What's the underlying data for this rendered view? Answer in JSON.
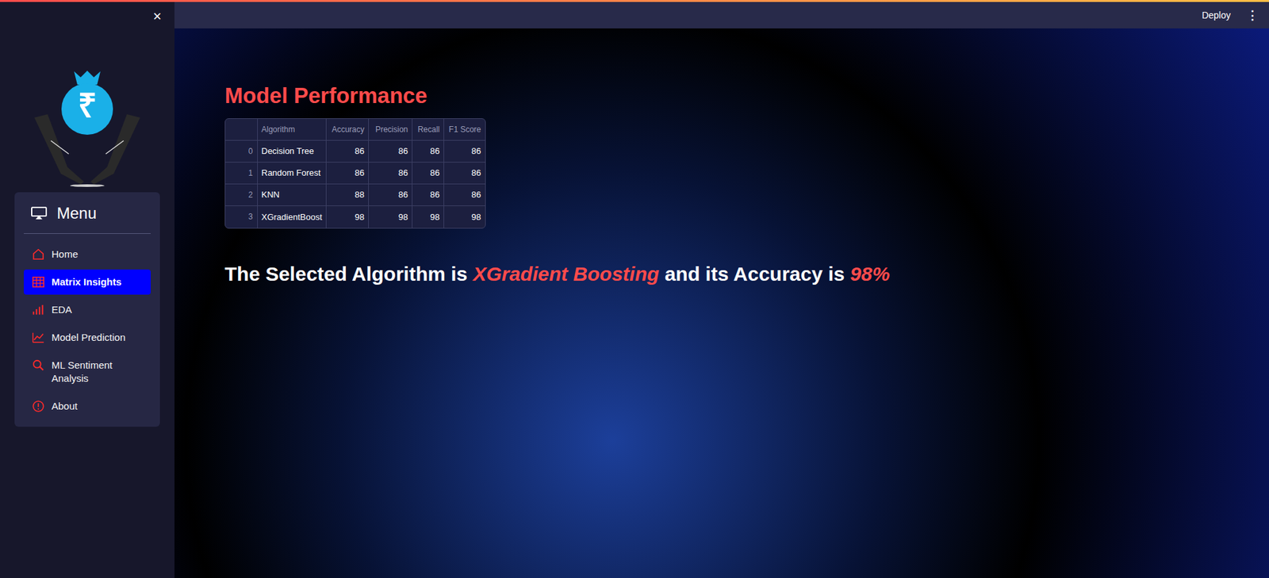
{
  "sidebar": {
    "close": "×",
    "logo_symbol": "₹",
    "menu_title": "Menu",
    "items": [
      {
        "label": "Home",
        "selected": false
      },
      {
        "label": "Matrix Insights",
        "selected": true
      },
      {
        "label": "EDA",
        "selected": false
      },
      {
        "label": "Model Prediction",
        "selected": false
      },
      {
        "label": "ML Sentiment Analysis",
        "selected": false
      },
      {
        "label": "About",
        "selected": false
      }
    ]
  },
  "header": {
    "deploy": "Deploy",
    "more": "⋮"
  },
  "main": {
    "title": "Model Performance",
    "table": {
      "columns": [
        "",
        "Algorithm",
        "Accuracy",
        "Precision",
        "Recall",
        "F1 Score"
      ],
      "rows": [
        [
          "0",
          "Decision Tree",
          "86",
          "86",
          "86",
          "86"
        ],
        [
          "1",
          "Random Forest",
          "86",
          "86",
          "86",
          "86"
        ],
        [
          "2",
          "KNN",
          "88",
          "86",
          "86",
          "86"
        ],
        [
          "3",
          "XGradientBoost",
          "98",
          "98",
          "98",
          "98"
        ]
      ]
    },
    "result": {
      "prefix": "The Selected Algorithm is ",
      "algorithm": "XGradient Boosting",
      "middle": " and its Accuracy is ",
      "accuracy": "98%"
    }
  }
}
